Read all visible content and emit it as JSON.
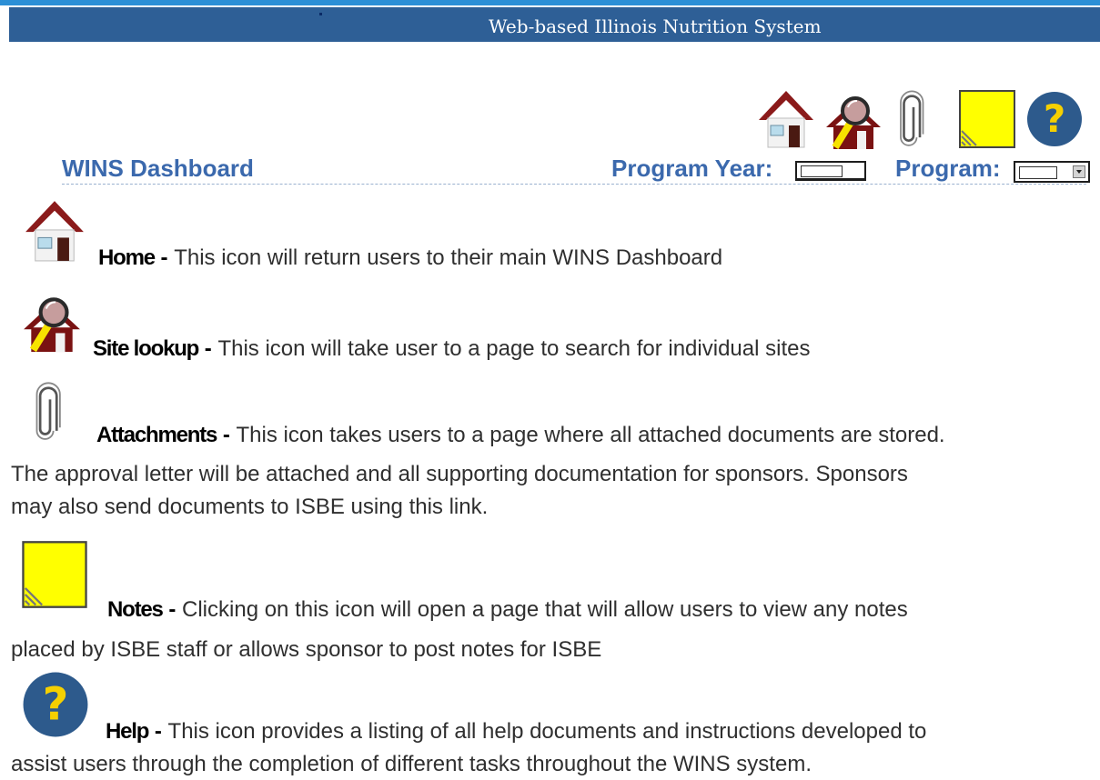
{
  "header": {
    "system_title": "Web-based Illinois Nutrition System"
  },
  "toolbar": {
    "icons": [
      "home-icon",
      "site-lookup-icon",
      "attachment-icon",
      "notes-icon",
      "help-icon"
    ]
  },
  "dashboard": {
    "title": "WINS Dashboard",
    "program_year_label": "Program Year:",
    "program_year_value": "",
    "program_label": "Program:",
    "program_value": ""
  },
  "colors": {
    "banner": "#2e5f96",
    "accent_text": "#3b69ad",
    "house_roof": "#8b1a1a",
    "notes_yellow": "#ffff00",
    "help_blue": "#2d5a8c"
  },
  "descriptions": {
    "home": {
      "term": "Home",
      "sep": " - ",
      "line1": "This icon will return users to their main WINS Dashboard"
    },
    "site_lookup": {
      "term": "Site lookup",
      "sep": " - ",
      "line1": "This icon will take user to a page to search for individual sites"
    },
    "attachments": {
      "term": "Attachments",
      "sep": " - ",
      "line1": "This icon takes users to a page where all attached documents are stored.",
      "line2": "The approval letter will be attached and all supporting documentation for sponsors.  Sponsors",
      "line3": "may also send documents to ISBE using this link."
    },
    "notes": {
      "term": "Notes",
      "sep": " - ",
      "line1": "Clicking on this icon will open a page that will allow users to view any notes",
      "line2": "placed by ISBE staff or allows sponsor to post notes for ISBE"
    },
    "help": {
      "term": "Help",
      "sep": " - ",
      "line1": "This icon provides a listing of all help documents and instructions developed to",
      "line2": "assist users through the completion of different tasks throughout the WINS system."
    }
  }
}
